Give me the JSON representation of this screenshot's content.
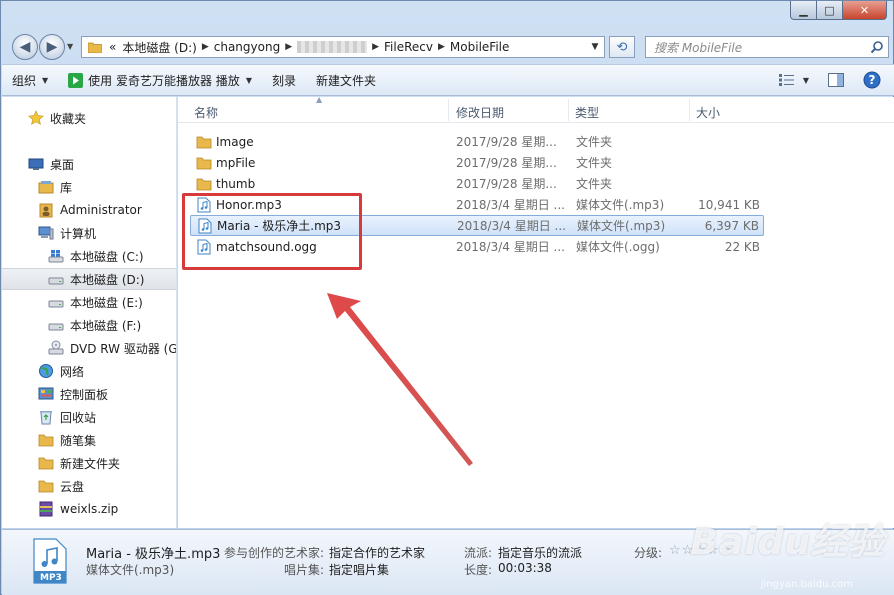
{
  "window": {
    "caption": {
      "minimize": "▁",
      "maximize": "□",
      "close": "✕"
    }
  },
  "address": {
    "crumbs": [
      "本地磁盘 (D:)",
      "changyong",
      "FileRecv",
      "MobileFile"
    ],
    "prefix": "«",
    "search_placeholder": "搜索 MobileFile"
  },
  "toolbar": {
    "organize": "组织",
    "play_with": "使用 爱奇艺万能播放器 播放",
    "burn": "刻录",
    "new_folder": "新建文件夹"
  },
  "nav": {
    "favorites": "收藏夹",
    "desktop": "桌面",
    "library": "库",
    "administrator": "Administrator",
    "computer": "计算机",
    "drive_c": "本地磁盘 (C:)",
    "drive_d": "本地磁盘 (D:)",
    "drive_e": "本地磁盘 (E:)",
    "drive_f": "本地磁盘 (F:)",
    "dvd": "DVD RW 驱动器 (G",
    "network": "网络",
    "control_panel": "控制面板",
    "recycle": "回收站",
    "notes": "随笔集",
    "new_folder": "新建文件夹",
    "cloud": "云盘",
    "zip": "weixls.zip"
  },
  "columns": {
    "name": "名称",
    "date": "修改日期",
    "type": "类型",
    "size": "大小"
  },
  "files": [
    {
      "name": "Image",
      "date": "2017/9/28 星期...",
      "type": "文件夹",
      "size": "",
      "kind": "folder"
    },
    {
      "name": "mpFile",
      "date": "2017/9/28 星期...",
      "type": "文件夹",
      "size": "",
      "kind": "folder"
    },
    {
      "name": "thumb",
      "date": "2017/9/28 星期...",
      "type": "文件夹",
      "size": "",
      "kind": "folder"
    },
    {
      "name": "Honor.mp3",
      "date": "2018/3/4 星期日 ...",
      "type": "媒体文件(.mp3)",
      "size": "10,941 KB",
      "kind": "audio"
    },
    {
      "name": "Maria - 极乐净土.mp3",
      "date": "2018/3/4 星期日 ...",
      "type": "媒体文件(.mp3)",
      "size": "6,397 KB",
      "kind": "audio"
    },
    {
      "name": "matchsound.ogg",
      "date": "2018/3/4 星期日 ...",
      "type": "媒体文件(.ogg)",
      "size": "22 KB",
      "kind": "audio"
    }
  ],
  "details": {
    "icon_label": "MP3",
    "name": "Maria - 极乐净土.mp3",
    "type": "媒体文件(.mp3)",
    "artist_label": "参与创作的艺术家:",
    "artist_value": "指定合作的艺术家",
    "album_label": "唱片集:",
    "album_value": "指定唱片集",
    "genre_label": "流派:",
    "genre_value": "指定音乐的流派",
    "length_label": "长度:",
    "length_value": "00:03:38",
    "rating_label": "分级:",
    "rating_stars": "☆☆☆☆☆"
  },
  "watermark": {
    "brand": "Baidu经验",
    "url": "jingyan.baidu.com"
  },
  "colors": {
    "annotation": "#d63a3a",
    "folder": "#e8b94a",
    "selection": "#cfe2f9"
  }
}
